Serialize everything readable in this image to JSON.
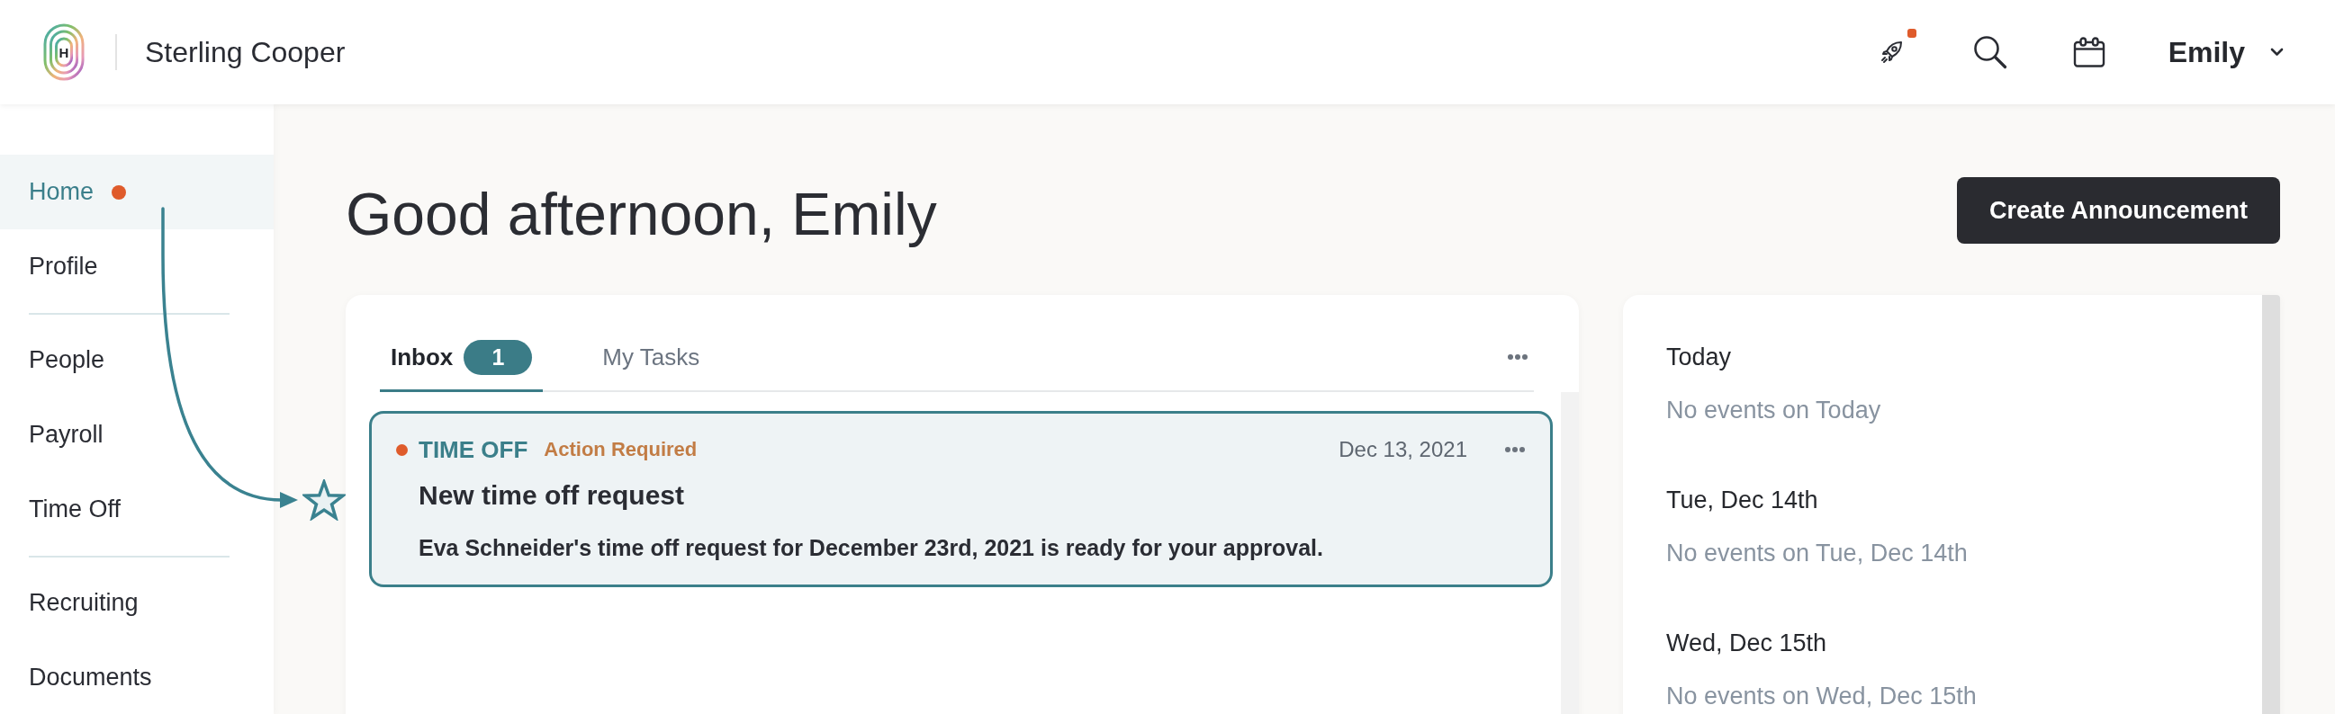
{
  "header": {
    "logo_letter": "H",
    "company": "Sterling Cooper",
    "rocket_badge": true,
    "user": "Emily"
  },
  "sidebar": {
    "groups": [
      {
        "items": [
          {
            "label": "Home",
            "selected": true,
            "dot": true
          },
          {
            "label": "Profile",
            "selected": false,
            "dot": false
          }
        ]
      },
      {
        "items": [
          {
            "label": "People",
            "selected": false,
            "dot": false
          },
          {
            "label": "Payroll",
            "selected": false,
            "dot": false
          },
          {
            "label": "Time Off",
            "selected": false,
            "dot": false
          }
        ]
      },
      {
        "items": [
          {
            "label": "Recruiting",
            "selected": false,
            "dot": false
          },
          {
            "label": "Documents",
            "selected": false,
            "dot": false
          }
        ]
      }
    ]
  },
  "greeting": "Good afternoon, Emily",
  "actions": [
    "Create Announcement"
  ],
  "inbox": {
    "tabs": [
      {
        "label": "Inbox",
        "count": "1",
        "selected": true
      },
      {
        "label": "My Tasks",
        "selected": false
      }
    ],
    "items": [
      {
        "category": "TIME OFF",
        "status": "Action Required",
        "date": "Dec 13, 2021",
        "title": "New time off request",
        "body": "Eva Schneider's time off request for December 23rd, 2021 is ready for your approval.",
        "unread": true,
        "selected": true
      }
    ]
  },
  "calendar": {
    "days": [
      {
        "heading": "Today",
        "note": "No events on Today"
      },
      {
        "heading": "Tue, Dec 14th",
        "note": "No events on Tue, Dec 14th"
      },
      {
        "heading": "Wed, Dec 15th",
        "note": "No events on Wed, Dec 15th"
      }
    ]
  }
}
